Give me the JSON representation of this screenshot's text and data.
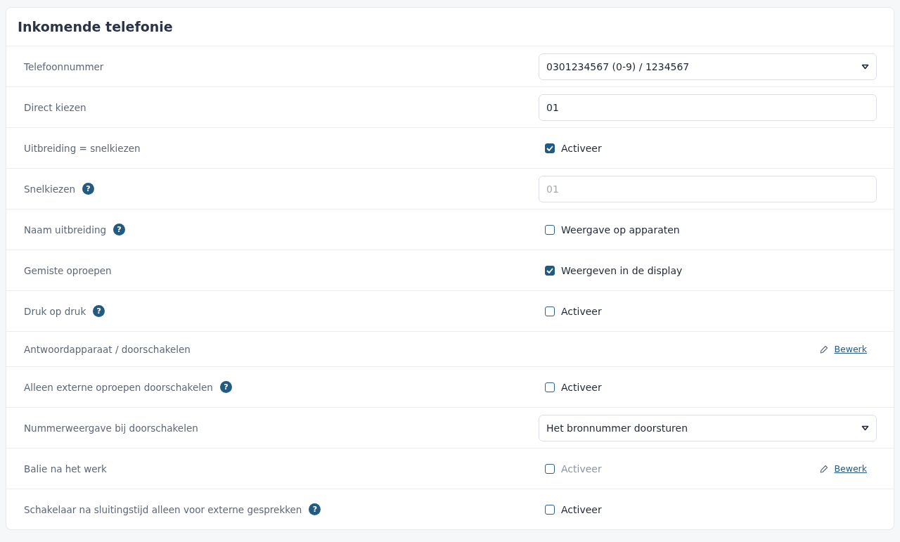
{
  "card": {
    "title": "Inkomende telefonie"
  },
  "rows": [
    {
      "label": "Telefoonnummer",
      "control": {
        "kind": "select",
        "value": "0301234567 (0-9) / 1234567"
      }
    },
    {
      "label": "Direct kiezen",
      "control": {
        "kind": "input",
        "value": "01"
      }
    },
    {
      "label": "Uitbreiding = snelkiezen",
      "control": {
        "kind": "checkbox",
        "checked": true,
        "disabled": false,
        "text": "Activeer"
      }
    },
    {
      "label": "Snelkiezen",
      "help": "?",
      "control": {
        "kind": "input",
        "placeholder": "01"
      }
    },
    {
      "label": "Naam uitbreiding",
      "help": "?",
      "control": {
        "kind": "checkbox",
        "checked": false,
        "disabled": false,
        "text": "Weergave op apparaten"
      }
    },
    {
      "label": "Gemiste oproepen",
      "control": {
        "kind": "checkbox",
        "checked": true,
        "disabled": false,
        "text": "Weergeven in de display"
      }
    },
    {
      "label": "Druk op druk",
      "help": "?",
      "control": {
        "kind": "checkbox",
        "checked": false,
        "disabled": false,
        "text": "Activeer"
      }
    },
    {
      "label": "Antwoordapparaat / doorschakelen",
      "edit": "Bewerk"
    },
    {
      "label": "Alleen externe oproepen doorschakelen",
      "help": "?",
      "control": {
        "kind": "checkbox",
        "checked": false,
        "disabled": false,
        "text": "Activeer"
      }
    },
    {
      "label": "Nummerweergave bij doorschakelen",
      "control": {
        "kind": "select",
        "value": "Het bronnummer doorsturen"
      }
    },
    {
      "label": "Balie na het werk",
      "control": {
        "kind": "checkbox",
        "checked": false,
        "disabled": true,
        "text": "Activeer"
      },
      "edit": "Bewerk"
    },
    {
      "label": "Schakelaar na sluitingstijd alleen voor externe gesprekken",
      "help": "?",
      "control": {
        "kind": "checkbox",
        "checked": false,
        "disabled": false,
        "text": "Activeer"
      }
    }
  ]
}
